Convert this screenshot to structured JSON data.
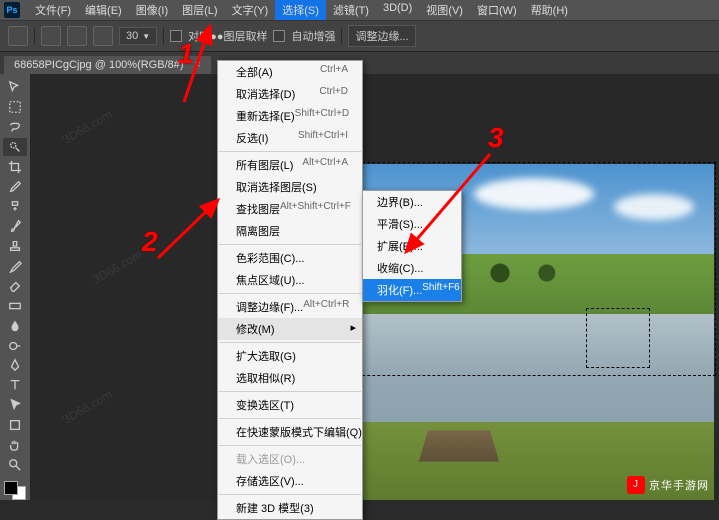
{
  "menubar": {
    "items": [
      "文件(F)",
      "编辑(E)",
      "图像(I)",
      "图层(L)",
      "文字(Y)",
      "选择(S)",
      "滤镜(T)",
      "3D(D)",
      "视图(V)",
      "窗口(W)",
      "帮助(H)"
    ],
    "highlight_index": 5
  },
  "optbar": {
    "tol_value": "30",
    "checkbox1": "对听●●图层取样",
    "checkbox2": "自动增强",
    "refine": "调整边缘..."
  },
  "tab": {
    "label": "68658PICgCjpg @ 100%(RGB/8#)"
  },
  "menu1": [
    {
      "l": "全部(A)",
      "s": "Ctrl+A"
    },
    {
      "l": "取消选择(D)",
      "s": "Ctrl+D"
    },
    {
      "l": "重新选择(E)",
      "s": "Shift+Ctrl+D"
    },
    {
      "l": "反选(I)",
      "s": "Shift+Ctrl+I"
    },
    {
      "sep": true
    },
    {
      "l": "所有图层(L)",
      "s": "Alt+Ctrl+A"
    },
    {
      "l": "取消选择图层(S)",
      "s": ""
    },
    {
      "l": "查找图层",
      "s": "Alt+Shift+Ctrl+F"
    },
    {
      "l": "隔离图层",
      "s": ""
    },
    {
      "sep": true
    },
    {
      "l": "色彩范围(C)...",
      "s": ""
    },
    {
      "l": "焦点区域(U)...",
      "s": ""
    },
    {
      "sep": true
    },
    {
      "l": "调整边缘(F)...",
      "s": "Alt+Ctrl+R"
    },
    {
      "l": "修改(M)",
      "s": "",
      "sub": true,
      "hi": true
    },
    {
      "sep": true
    },
    {
      "l": "扩大选取(G)",
      "s": ""
    },
    {
      "l": "选取相似(R)",
      "s": ""
    },
    {
      "sep": true
    },
    {
      "l": "变换选区(T)",
      "s": ""
    },
    {
      "sep": true
    },
    {
      "l": "在快速蒙版模式下编辑(Q)",
      "s": ""
    },
    {
      "sep": true
    },
    {
      "l": "载入选区(O)...",
      "s": "",
      "dis": true
    },
    {
      "l": "存储选区(V)...",
      "s": ""
    },
    {
      "sep": true
    },
    {
      "l": "新建 3D 模型(3)",
      "s": ""
    }
  ],
  "menu2": [
    {
      "l": "边界(B)...",
      "s": ""
    },
    {
      "l": "平滑(S)...",
      "s": ""
    },
    {
      "l": "扩展(E)...",
      "s": ""
    },
    {
      "l": "收缩(C)...",
      "s": ""
    },
    {
      "l": "羽化(F)...",
      "s": "Shift+F6",
      "hl": true
    }
  ],
  "anno": {
    "a": "1",
    "b": "2",
    "c": "3"
  },
  "brand": "京华手游网",
  "wm": "3D66.com"
}
